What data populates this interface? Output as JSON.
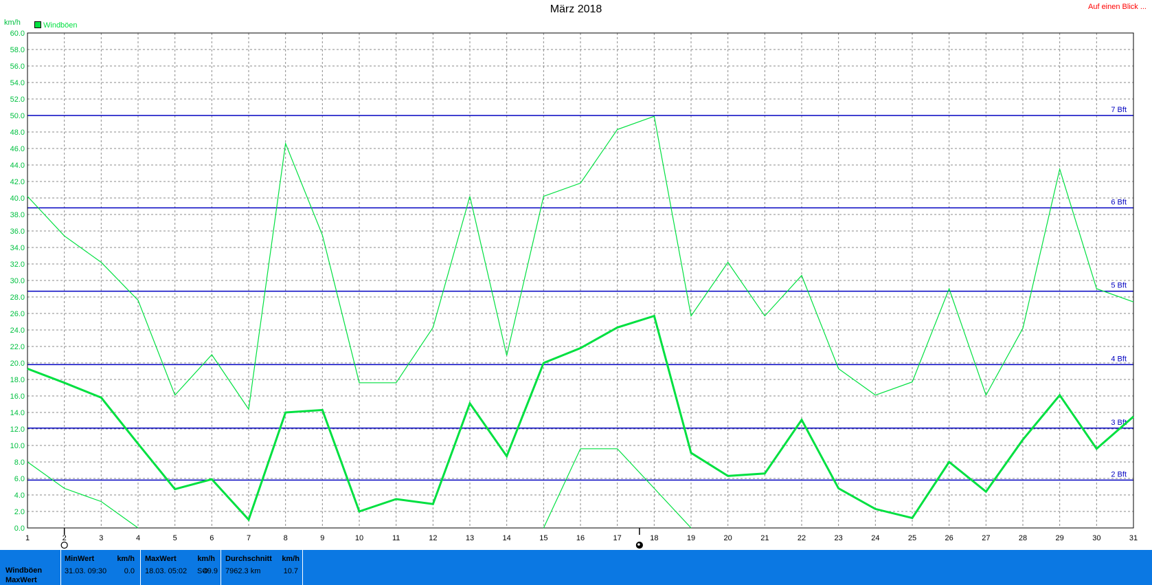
{
  "header": {
    "title": "März 2018",
    "quick_link": "Auf einen Blick ...",
    "unit": "km/h",
    "legend_label": "Windböen"
  },
  "chart_data": {
    "type": "line",
    "title": "März 2018",
    "ylabel": "km/h",
    "ylim": [
      0,
      60
    ],
    "y_tick_step": 2,
    "x": [
      1,
      2,
      3,
      4,
      5,
      6,
      7,
      8,
      9,
      10,
      11,
      12,
      13,
      14,
      15,
      16,
      17,
      18,
      19,
      20,
      21,
      22,
      23,
      24,
      25,
      26,
      27,
      28,
      29,
      30,
      31
    ],
    "grid": true,
    "legend_position": "top-left",
    "series": [
      {
        "name": "Windböen",
        "role": "mean",
        "color": "#00e040",
        "values": [
          19.3,
          17.6,
          15.8,
          10.2,
          4.7,
          5.9,
          1.0,
          14.0,
          14.3,
          2.0,
          3.5,
          2.9,
          15.1,
          8.7,
          20.0,
          21.8,
          24.3,
          25.7,
          9.1,
          6.3,
          6.6,
          13.1,
          4.8,
          2.3,
          1.2,
          8.0,
          4.4,
          10.7,
          16.1,
          9.6,
          13.5
        ]
      },
      {
        "role": "max",
        "color": "#00e040",
        "values": [
          40.2,
          35.4,
          32.2,
          27.6,
          16.1,
          21.0,
          14.4,
          46.6,
          35.5,
          17.6,
          17.6,
          24.3,
          40.2,
          20.9,
          40.2,
          41.8,
          48.3,
          49.9,
          25.7,
          32.2,
          25.7,
          30.6,
          19.3,
          16.1,
          17.7,
          29.0,
          16.1,
          24.2,
          43.5,
          29.0,
          27.4
        ]
      },
      {
        "role": "min",
        "color": "#00e040",
        "values": [
          8.0,
          4.8,
          3.2,
          0.0,
          null,
          null,
          null,
          null,
          null,
          null,
          null,
          null,
          null,
          null,
          0.0,
          9.6,
          9.6,
          4.8,
          0.0,
          null,
          null,
          null,
          null,
          null,
          null,
          null,
          null,
          null,
          null,
          null,
          null
        ]
      }
    ],
    "reference_lines": [
      {
        "label": "7 Bft",
        "value": 50.0,
        "color": "#0000c0"
      },
      {
        "label": "6 Bft",
        "value": 38.8,
        "color": "#0000c0"
      },
      {
        "label": "5 Bft",
        "value": 28.7,
        "color": "#0000c0"
      },
      {
        "label": "4 Bft",
        "value": 19.8,
        "color": "#0000c0"
      },
      {
        "label": "3 Bft",
        "value": 12.1,
        "color": "#0000c0"
      },
      {
        "label": "2 Bft",
        "value": 5.8,
        "color": "#0000c0"
      }
    ],
    "markers": [
      {
        "day": 2,
        "symbol": "new-moon-icon"
      },
      {
        "day": 17.6,
        "symbol": "full-moon-icon"
      }
    ]
  },
  "summary": {
    "row_labels": [
      "Windböen",
      "MaxWert"
    ],
    "columns": [
      {
        "header": "MinWert",
        "unit": "km/h",
        "when": "31.03.  09:30",
        "value": "0.0"
      },
      {
        "header": "MaxWert",
        "unit": "km/h",
        "when": "18.03.  05:02",
        "dir": "SO",
        "value": "49.9"
      },
      {
        "header": "Durchschnitt",
        "unit": "km/h",
        "when": "7962.3 km",
        "value": "10.7"
      }
    ]
  },
  "colors": {
    "footer_bg": "#0b78e3",
    "series": "#00e040",
    "beaufort": "#0000c0",
    "axis_text": "#00c040"
  }
}
